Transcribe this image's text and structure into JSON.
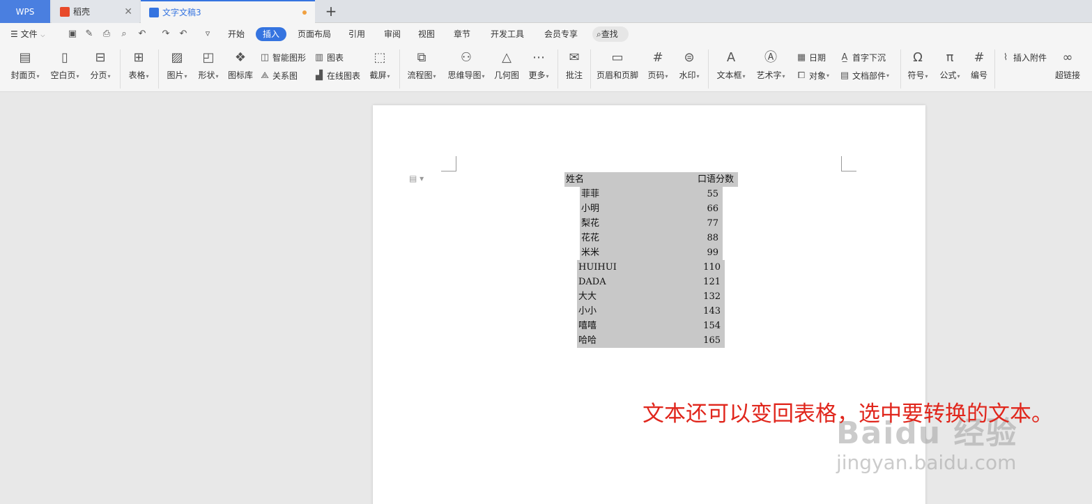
{
  "tabs": {
    "wps": "WPS",
    "daoke": "稻壳",
    "document": "文字文稿3"
  },
  "menubar": {
    "file": "文件",
    "items": [
      "开始",
      "插入",
      "页面布局",
      "引用",
      "审阅",
      "视图",
      "章节",
      "开发工具",
      "会员专享"
    ],
    "active": "插入",
    "search": "查找"
  },
  "ribbon": {
    "cover": "封面页",
    "blank": "空白页",
    "pagebreak": "分页",
    "table": "表格",
    "picture": "图片",
    "shape": "形状",
    "iconlib": "图标库",
    "smartart": "智能图形",
    "chart": "图表",
    "relation": "关系图",
    "onlinechart": "在线图表",
    "screenshot": "截屏",
    "flowchart": "流程图",
    "mindmap": "思维导图",
    "geometry": "几何图",
    "more": "更多",
    "comment": "批注",
    "headerfooter": "页眉和页脚",
    "pagenum": "页码",
    "watermark": "水印",
    "textbox": "文本框",
    "wordart": "艺术字",
    "date": "日期",
    "dropcap": "首字下沉",
    "object": "对象",
    "docpart": "文档部件",
    "symbol": "符号",
    "formula": "公式",
    "numbering": "编号",
    "attachment": "插入附件",
    "hyperlink": "超链接"
  },
  "table_text": {
    "header": [
      "姓名",
      "口语分数"
    ],
    "rows": [
      [
        "菲菲",
        "55"
      ],
      [
        "小明",
        "66"
      ],
      [
        "梨花",
        "77"
      ],
      [
        "花花",
        "88"
      ],
      [
        "米米",
        "99"
      ],
      [
        "HUIHUI",
        "110"
      ],
      [
        "DADA",
        "121"
      ],
      [
        "大大",
        "132"
      ],
      [
        "小小",
        "143"
      ],
      [
        "嘻嘻",
        "154"
      ],
      [
        "哈哈",
        "165"
      ]
    ]
  },
  "annotation": "文本还可以变回表格，选中要转换的文本。",
  "watermark": {
    "line1": "Baidu 经验",
    "line2": "jingyan.baidu.com"
  },
  "colors": {
    "accent": "#3574e0",
    "annotation": "#e0261c",
    "selection": "#c8c8c8"
  }
}
